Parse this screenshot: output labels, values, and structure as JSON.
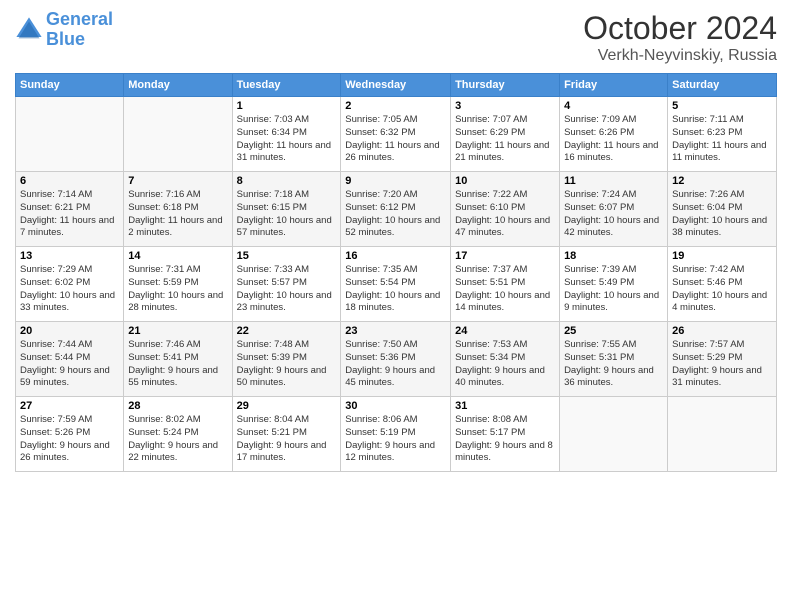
{
  "logo": {
    "line1": "General",
    "line2": "Blue"
  },
  "title": "October 2024",
  "location": "Verkh-Neyvinskiy, Russia",
  "days_header": [
    "Sunday",
    "Monday",
    "Tuesday",
    "Wednesday",
    "Thursday",
    "Friday",
    "Saturday"
  ],
  "weeks": [
    [
      {
        "num": "",
        "info": ""
      },
      {
        "num": "",
        "info": ""
      },
      {
        "num": "1",
        "info": "Sunrise: 7:03 AM\nSunset: 6:34 PM\nDaylight: 11 hours and 31 minutes."
      },
      {
        "num": "2",
        "info": "Sunrise: 7:05 AM\nSunset: 6:32 PM\nDaylight: 11 hours and 26 minutes."
      },
      {
        "num": "3",
        "info": "Sunrise: 7:07 AM\nSunset: 6:29 PM\nDaylight: 11 hours and 21 minutes."
      },
      {
        "num": "4",
        "info": "Sunrise: 7:09 AM\nSunset: 6:26 PM\nDaylight: 11 hours and 16 minutes."
      },
      {
        "num": "5",
        "info": "Sunrise: 7:11 AM\nSunset: 6:23 PM\nDaylight: 11 hours and 11 minutes."
      }
    ],
    [
      {
        "num": "6",
        "info": "Sunrise: 7:14 AM\nSunset: 6:21 PM\nDaylight: 11 hours and 7 minutes."
      },
      {
        "num": "7",
        "info": "Sunrise: 7:16 AM\nSunset: 6:18 PM\nDaylight: 11 hours and 2 minutes."
      },
      {
        "num": "8",
        "info": "Sunrise: 7:18 AM\nSunset: 6:15 PM\nDaylight: 10 hours and 57 minutes."
      },
      {
        "num": "9",
        "info": "Sunrise: 7:20 AM\nSunset: 6:12 PM\nDaylight: 10 hours and 52 minutes."
      },
      {
        "num": "10",
        "info": "Sunrise: 7:22 AM\nSunset: 6:10 PM\nDaylight: 10 hours and 47 minutes."
      },
      {
        "num": "11",
        "info": "Sunrise: 7:24 AM\nSunset: 6:07 PM\nDaylight: 10 hours and 42 minutes."
      },
      {
        "num": "12",
        "info": "Sunrise: 7:26 AM\nSunset: 6:04 PM\nDaylight: 10 hours and 38 minutes."
      }
    ],
    [
      {
        "num": "13",
        "info": "Sunrise: 7:29 AM\nSunset: 6:02 PM\nDaylight: 10 hours and 33 minutes."
      },
      {
        "num": "14",
        "info": "Sunrise: 7:31 AM\nSunset: 5:59 PM\nDaylight: 10 hours and 28 minutes."
      },
      {
        "num": "15",
        "info": "Sunrise: 7:33 AM\nSunset: 5:57 PM\nDaylight: 10 hours and 23 minutes."
      },
      {
        "num": "16",
        "info": "Sunrise: 7:35 AM\nSunset: 5:54 PM\nDaylight: 10 hours and 18 minutes."
      },
      {
        "num": "17",
        "info": "Sunrise: 7:37 AM\nSunset: 5:51 PM\nDaylight: 10 hours and 14 minutes."
      },
      {
        "num": "18",
        "info": "Sunrise: 7:39 AM\nSunset: 5:49 PM\nDaylight: 10 hours and 9 minutes."
      },
      {
        "num": "19",
        "info": "Sunrise: 7:42 AM\nSunset: 5:46 PM\nDaylight: 10 hours and 4 minutes."
      }
    ],
    [
      {
        "num": "20",
        "info": "Sunrise: 7:44 AM\nSunset: 5:44 PM\nDaylight: 9 hours and 59 minutes."
      },
      {
        "num": "21",
        "info": "Sunrise: 7:46 AM\nSunset: 5:41 PM\nDaylight: 9 hours and 55 minutes."
      },
      {
        "num": "22",
        "info": "Sunrise: 7:48 AM\nSunset: 5:39 PM\nDaylight: 9 hours and 50 minutes."
      },
      {
        "num": "23",
        "info": "Sunrise: 7:50 AM\nSunset: 5:36 PM\nDaylight: 9 hours and 45 minutes."
      },
      {
        "num": "24",
        "info": "Sunrise: 7:53 AM\nSunset: 5:34 PM\nDaylight: 9 hours and 40 minutes."
      },
      {
        "num": "25",
        "info": "Sunrise: 7:55 AM\nSunset: 5:31 PM\nDaylight: 9 hours and 36 minutes."
      },
      {
        "num": "26",
        "info": "Sunrise: 7:57 AM\nSunset: 5:29 PM\nDaylight: 9 hours and 31 minutes."
      }
    ],
    [
      {
        "num": "27",
        "info": "Sunrise: 7:59 AM\nSunset: 5:26 PM\nDaylight: 9 hours and 26 minutes."
      },
      {
        "num": "28",
        "info": "Sunrise: 8:02 AM\nSunset: 5:24 PM\nDaylight: 9 hours and 22 minutes."
      },
      {
        "num": "29",
        "info": "Sunrise: 8:04 AM\nSunset: 5:21 PM\nDaylight: 9 hours and 17 minutes."
      },
      {
        "num": "30",
        "info": "Sunrise: 8:06 AM\nSunset: 5:19 PM\nDaylight: 9 hours and 12 minutes."
      },
      {
        "num": "31",
        "info": "Sunrise: 8:08 AM\nSunset: 5:17 PM\nDaylight: 9 hours and 8 minutes."
      },
      {
        "num": "",
        "info": ""
      },
      {
        "num": "",
        "info": ""
      }
    ]
  ]
}
